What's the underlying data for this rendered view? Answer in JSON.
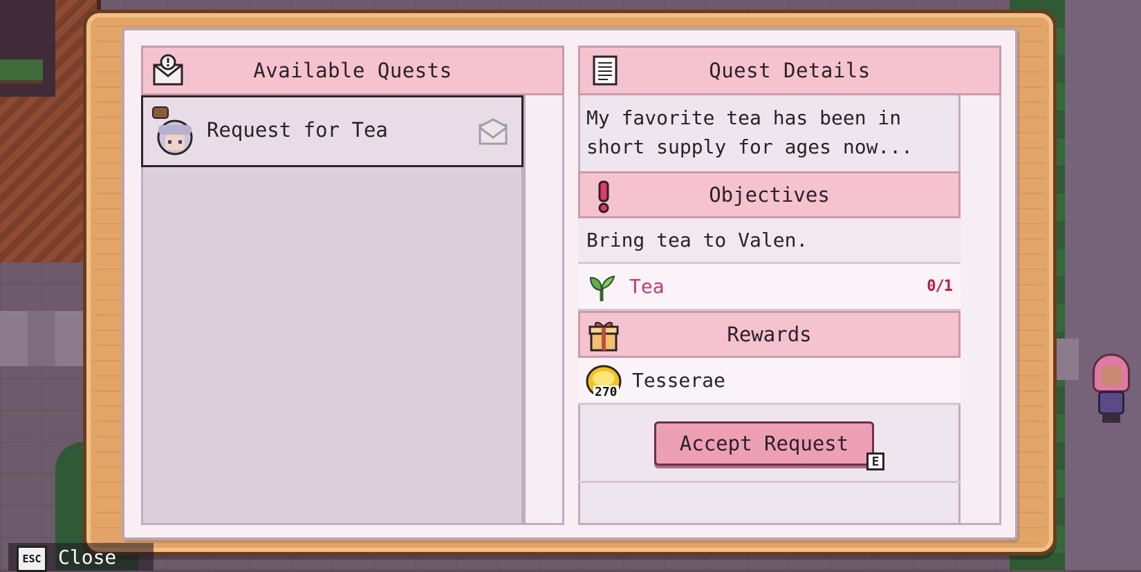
{
  "panels": {
    "available": {
      "title": "Available Quests"
    },
    "details": {
      "title": "Quest Details"
    }
  },
  "quests": [
    {
      "title": "Request for Tea",
      "giver_icon": "valen-portrait-icon",
      "status_icon": "envelope-icon"
    }
  ],
  "details": {
    "description_line1": "My favorite tea has been in",
    "description_line2": "short supply for ages now...",
    "objectives_title": "Objectives",
    "objective_text": "Bring tea to Valen.",
    "objective_item": {
      "name": "Tea",
      "progress": "0/1",
      "icon": "tea-leaf-icon"
    },
    "rewards_title": "Rewards",
    "reward": {
      "name": "Tesserae",
      "amount": "270",
      "icon": "coin-icon"
    },
    "accept_label": "Accept Request",
    "accept_key": "E"
  },
  "footer": {
    "close_key": "ESC",
    "close_label": "Close"
  },
  "colors": {
    "header_pink": "#f5c2cf",
    "button_pink": "#ec9fb5",
    "item_name_red": "#c43a68",
    "frame_orange": "#e2a567"
  }
}
